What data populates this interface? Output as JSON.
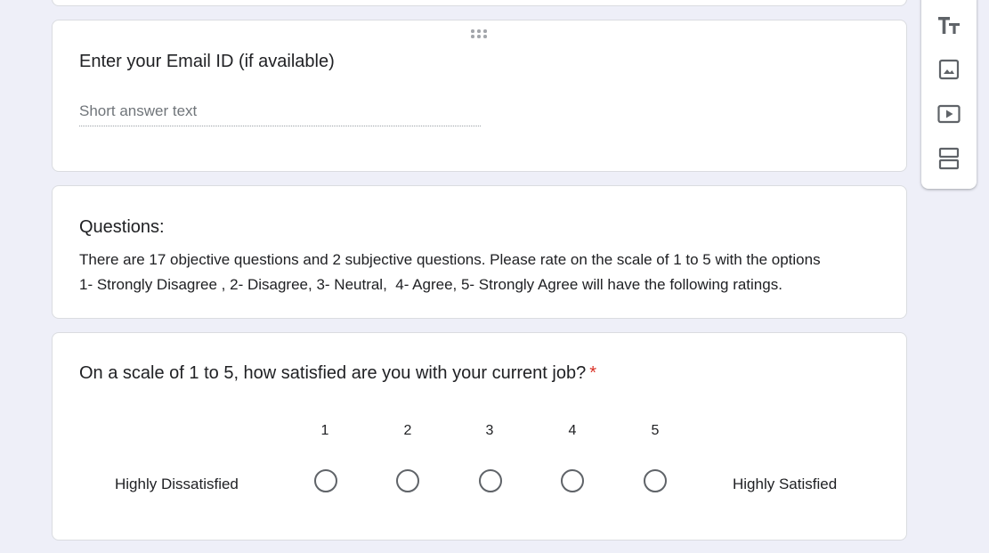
{
  "email_question": {
    "title": "Enter your Email ID (if available)",
    "placeholder": "Short answer text"
  },
  "questions_section": {
    "title": "Questions:",
    "description_lines": [
      "There are 17 objective questions and 2 subjective questions. Please rate on the scale of 1 to 5 with the options",
      "1- Strongly Disagree , 2- Disagree, 3- Neutral,  4- Agree, 5- Strongly Agree will have the following ratings."
    ]
  },
  "scale_question": {
    "title": "On a scale of 1 to 5, how satisfied are you with your current job?",
    "required_mark": "*",
    "low_label": "Highly Dissatisfied",
    "high_label": "Highly Satisfied",
    "options": [
      "1",
      "2",
      "3",
      "4",
      "5"
    ]
  },
  "sidebar": {
    "items": [
      {
        "name": "add-title-and-description",
        "icon": "title-icon"
      },
      {
        "name": "add-image",
        "icon": "image-icon"
      },
      {
        "name": "add-video",
        "icon": "video-icon"
      },
      {
        "name": "add-section",
        "icon": "section-icon"
      }
    ]
  },
  "colors": {
    "background": "#eeeff8",
    "required": "#d93025",
    "icon": "#5f6368"
  }
}
